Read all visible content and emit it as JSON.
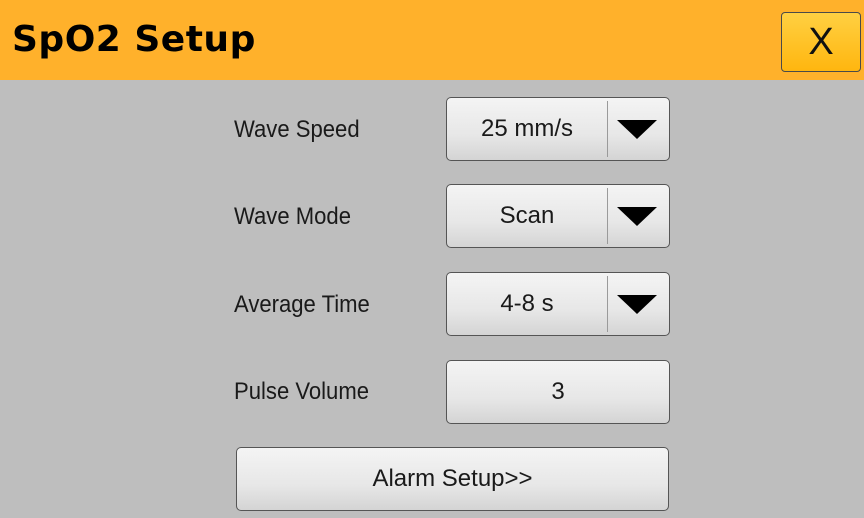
{
  "window": {
    "title": "SpO2 Setup",
    "close_label": "X"
  },
  "colors": {
    "title_bar": "#ffb12b",
    "background": "#bebebe",
    "button_face": "#ececec"
  },
  "settings": [
    {
      "label": "Wave Speed",
      "value": "25 mm/s",
      "control": "dropdown"
    },
    {
      "label": "Wave Mode",
      "value": "Scan",
      "control": "dropdown"
    },
    {
      "label": "Average Time",
      "value": "4-8 s",
      "control": "dropdown"
    },
    {
      "label": "Pulse Volume",
      "value": "3",
      "control": "button"
    }
  ],
  "alarm_setup_label": "Alarm Setup>>"
}
